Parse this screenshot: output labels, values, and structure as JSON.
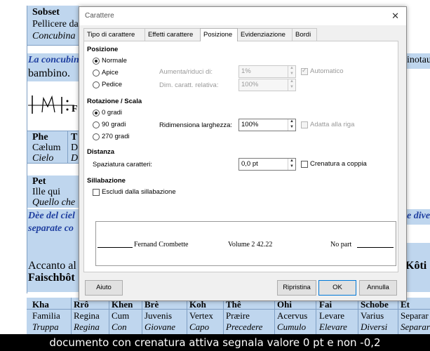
{
  "document": {
    "top_left": {
      "line1": "Sobset",
      "line2": "Pellicere da",
      "line3": "Concubina"
    },
    "paragraph_italic": "La concubin",
    "paragraph_right": "inotau",
    "paragraph_line2": "bambino.",
    "music_letter": "F",
    "cell_phe": {
      "h": "Phe",
      "a": "Cælum",
      "b": "Cielo"
    },
    "cell_t": {
      "h": "T",
      "a": "D",
      "b": "D"
    },
    "cell_pet": {
      "h": "Pet",
      "a": "Ille qui",
      "b": "Quello che"
    },
    "blue_para_line1": "Dèe del ciel",
    "blue_para_right": "e dive",
    "blue_para_line2": "separate co",
    "accanto": "Accanto al",
    "koti": "Kôti C",
    "faischbot": "Faischbôt",
    "table_rows": [
      {
        "h": "Kha",
        "a": "Familia",
        "b": "Truppa"
      },
      {
        "h": "Rrô",
        "a": "Regina",
        "b": "Regina"
      },
      {
        "h": "Khen",
        "a": "Cum",
        "b": "Con"
      },
      {
        "h": "Brè",
        "a": "Juvenis",
        "b": "Giovane"
      },
      {
        "h": "Koh",
        "a": "Vertex",
        "b": "Capo"
      },
      {
        "h": "Thê",
        "a": "Præire",
        "b": "Precedere"
      },
      {
        "h": "Ohi",
        "a": "Acervus",
        "b": "Cumulo"
      },
      {
        "h": "Fai",
        "a": "Levare",
        "b": "Elevare"
      },
      {
        "h": "Schobe",
        "a": "Varius",
        "b": "Diversi"
      },
      {
        "h": "Et",
        "a": "Separar",
        "b": "Separar"
      }
    ]
  },
  "dialog": {
    "title": "Carattere",
    "close_glyph": "✕",
    "tabs": [
      "Tipo di carattere",
      "Effetti carattere",
      "Posizione",
      "Evidenziazione",
      "Bordi"
    ],
    "active_tab": "Posizione",
    "position": {
      "heading": "Posizione",
      "options": [
        "Normale",
        "Apice",
        "Pedice"
      ],
      "selected": "Normale",
      "raise_lower_label": "Aumenta/riduci di:",
      "raise_lower_value": "1%",
      "automatic_label": "Automatico",
      "relative_size_label": "Dim. caratt. relativa:",
      "relative_size_value": "100%"
    },
    "rotation": {
      "heading": "Rotazione / Scala",
      "options": [
        "0 gradi",
        "90 gradi",
        "270 gradi"
      ],
      "selected": "0 gradi",
      "scale_width_label": "Ridimensiona larghezza:",
      "scale_width_value": "100%",
      "fit_to_line_label": "Adatta alla riga"
    },
    "spacing": {
      "heading": "Distanza",
      "char_spacing_label": "Spaziatura caratteri:",
      "char_spacing_value": "0,0 pt",
      "pair_kerning_label": "Crenatura a coppia",
      "pair_kerning_checked": false
    },
    "hyphenation": {
      "heading": "Sillabazione",
      "exclude_label": "Escludi dalla sillabazione",
      "exclude_checked": false
    },
    "preview": {
      "left_text": "Fernand Crombette",
      "mid_text": "Volume 2  42.22",
      "right_text": "No part"
    },
    "buttons": {
      "help": "Aiuto",
      "reset": "Ripristina",
      "ok": "OK",
      "cancel": "Annulla"
    }
  },
  "caption": "documento con crenatura attiva segnala valore 0 pt e non -0,2"
}
